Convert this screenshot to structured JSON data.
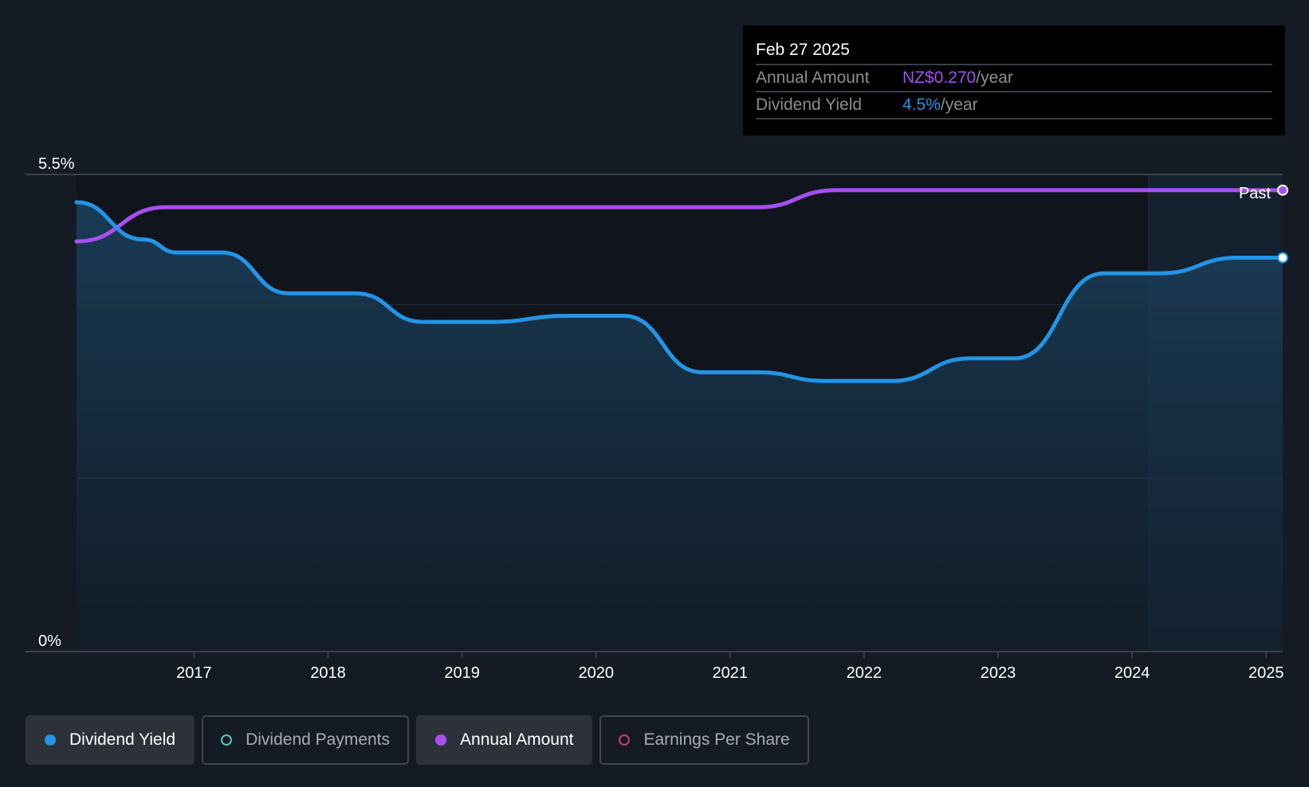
{
  "tooltip": {
    "date": "Feb 27 2025",
    "rows": [
      {
        "label": "Annual Amount",
        "value": "NZ$0.270",
        "suffix": "/year",
        "color": "#a64ff0"
      },
      {
        "label": "Dividend Yield",
        "value": "4.5%",
        "suffix": "/year",
        "color": "#2394e6"
      }
    ]
  },
  "legend": [
    {
      "label": "Dividend Yield",
      "active": true,
      "color": "#2394e6",
      "filled": true
    },
    {
      "label": "Dividend Payments",
      "active": false,
      "color": "#4fc7bd",
      "filled": false
    },
    {
      "label": "Annual Amount",
      "active": true,
      "color": "#a64ff0",
      "filled": true
    },
    {
      "label": "Earnings Per Share",
      "active": false,
      "color": "#c2407c",
      "filled": false
    }
  ],
  "chart_data": {
    "type": "line",
    "ylim": [
      0,
      5.5
    ],
    "y_tick_labels": [
      "0%",
      "5.5%"
    ],
    "gridlines_y": [
      2,
      4,
      5.5
    ],
    "x_range": [
      "2016-02",
      "2025-02"
    ],
    "x_tick_labels": [
      "2017",
      "2018",
      "2019",
      "2020",
      "2021",
      "2022",
      "2023",
      "2024",
      "2025"
    ],
    "past_region_start": "2024-02",
    "past_label": "Past",
    "series": [
      {
        "name": "Dividend Yield",
        "unit": "%",
        "color": "#2394e6",
        "area": true,
        "points": [
          [
            "2016-02",
            5.18
          ],
          [
            "2016-08",
            4.75
          ],
          [
            "2016-11",
            4.6
          ],
          [
            "2017-03",
            4.6
          ],
          [
            "2017-09",
            4.13
          ],
          [
            "2018-03",
            4.13
          ],
          [
            "2018-09",
            3.8
          ],
          [
            "2019-03",
            3.8
          ],
          [
            "2019-10",
            3.87
          ],
          [
            "2020-03",
            3.87
          ],
          [
            "2020-10",
            3.22
          ],
          [
            "2021-03",
            3.22
          ],
          [
            "2021-09",
            3.12
          ],
          [
            "2022-03",
            3.12
          ],
          [
            "2022-10",
            3.38
          ],
          [
            "2023-02",
            3.38
          ],
          [
            "2023-10",
            4.36
          ],
          [
            "2024-03",
            4.36
          ],
          [
            "2024-10",
            4.54
          ],
          [
            "2025-02",
            4.54
          ]
        ]
      },
      {
        "name": "Annual Amount",
        "unit": "NZ$",
        "color": "#a64ff0",
        "area": false,
        "points": [
          [
            "2016-02",
            0.24
          ],
          [
            "2016-10",
            0.26
          ],
          [
            "2021-03",
            0.26
          ],
          [
            "2021-10",
            0.27
          ],
          [
            "2025-02",
            0.27
          ]
        ]
      }
    ]
  }
}
